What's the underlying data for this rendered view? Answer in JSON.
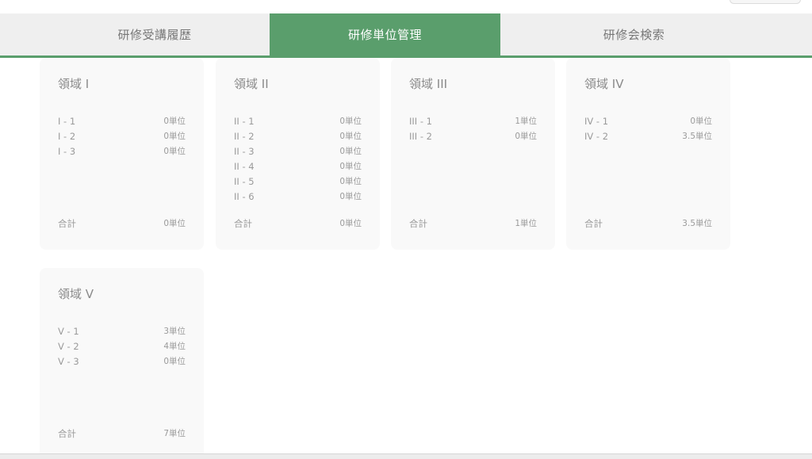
{
  "tabs": [
    {
      "label": "研修受講履歴",
      "active": false
    },
    {
      "label": "研修単位管理",
      "active": true
    },
    {
      "label": "研修会検索",
      "active": false
    }
  ],
  "accent_color": "#5a9e6c",
  "areas": [
    {
      "title": "領域 I",
      "rows": [
        {
          "label": "I - 1",
          "value": "0単位"
        },
        {
          "label": "I - 2",
          "value": "0単位"
        },
        {
          "label": "I - 3",
          "value": "0単位"
        }
      ],
      "total_label": "合計",
      "total_value": "0単位"
    },
    {
      "title": "領域 II",
      "rows": [
        {
          "label": "II - 1",
          "value": "0単位"
        },
        {
          "label": "II - 2",
          "value": "0単位"
        },
        {
          "label": "II - 3",
          "value": "0単位"
        },
        {
          "label": "II - 4",
          "value": "0単位"
        },
        {
          "label": "II - 5",
          "value": "0単位"
        },
        {
          "label": "II - 6",
          "value": "0単位"
        }
      ],
      "total_label": "合計",
      "total_value": "0単位"
    },
    {
      "title": "領域 III",
      "rows": [
        {
          "label": "III - 1",
          "value": "1単位"
        },
        {
          "label": "III - 2",
          "value": "0単位"
        }
      ],
      "total_label": "合計",
      "total_value": "1単位"
    },
    {
      "title": "領域 IV",
      "rows": [
        {
          "label": "IV - 1",
          "value": "0単位"
        },
        {
          "label": "IV - 2",
          "value": "3.5単位"
        }
      ],
      "total_label": "合計",
      "total_value": "3.5単位"
    },
    {
      "title": "領域 V",
      "rows": [
        {
          "label": "V - 1",
          "value": "3単位"
        },
        {
          "label": "V - 2",
          "value": "4単位"
        },
        {
          "label": "V - 3",
          "value": "0単位"
        }
      ],
      "total_label": "合計",
      "total_value": "7単位"
    }
  ]
}
